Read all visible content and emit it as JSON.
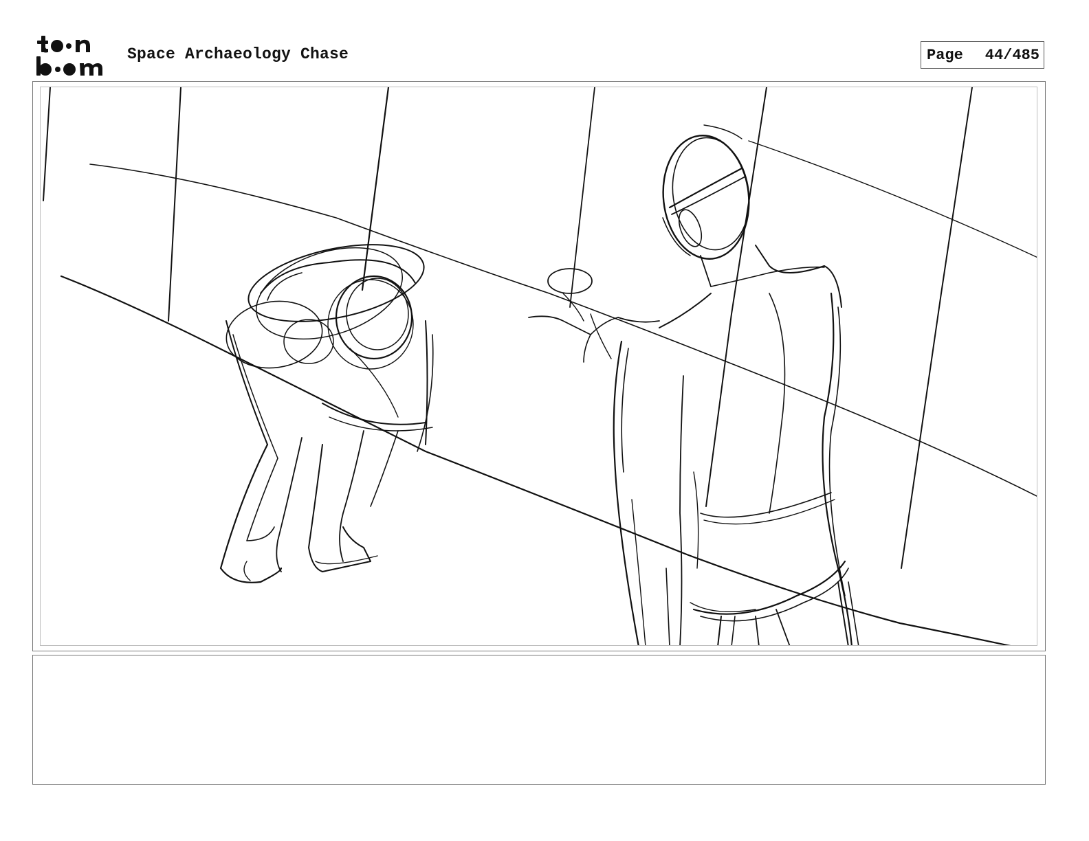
{
  "header": {
    "logo": {
      "line1": "toon",
      "line2": "boom",
      "alt": "toon boom logo"
    },
    "project_title": "Space Archaeology Chase",
    "page": {
      "label": "Page",
      "number": "44/485"
    }
  },
  "panel": {
    "icon": "storyboard-sketch"
  },
  "notes": {
    "text": ""
  },
  "colors": {
    "ink": "#111111",
    "frame": "#777777"
  }
}
